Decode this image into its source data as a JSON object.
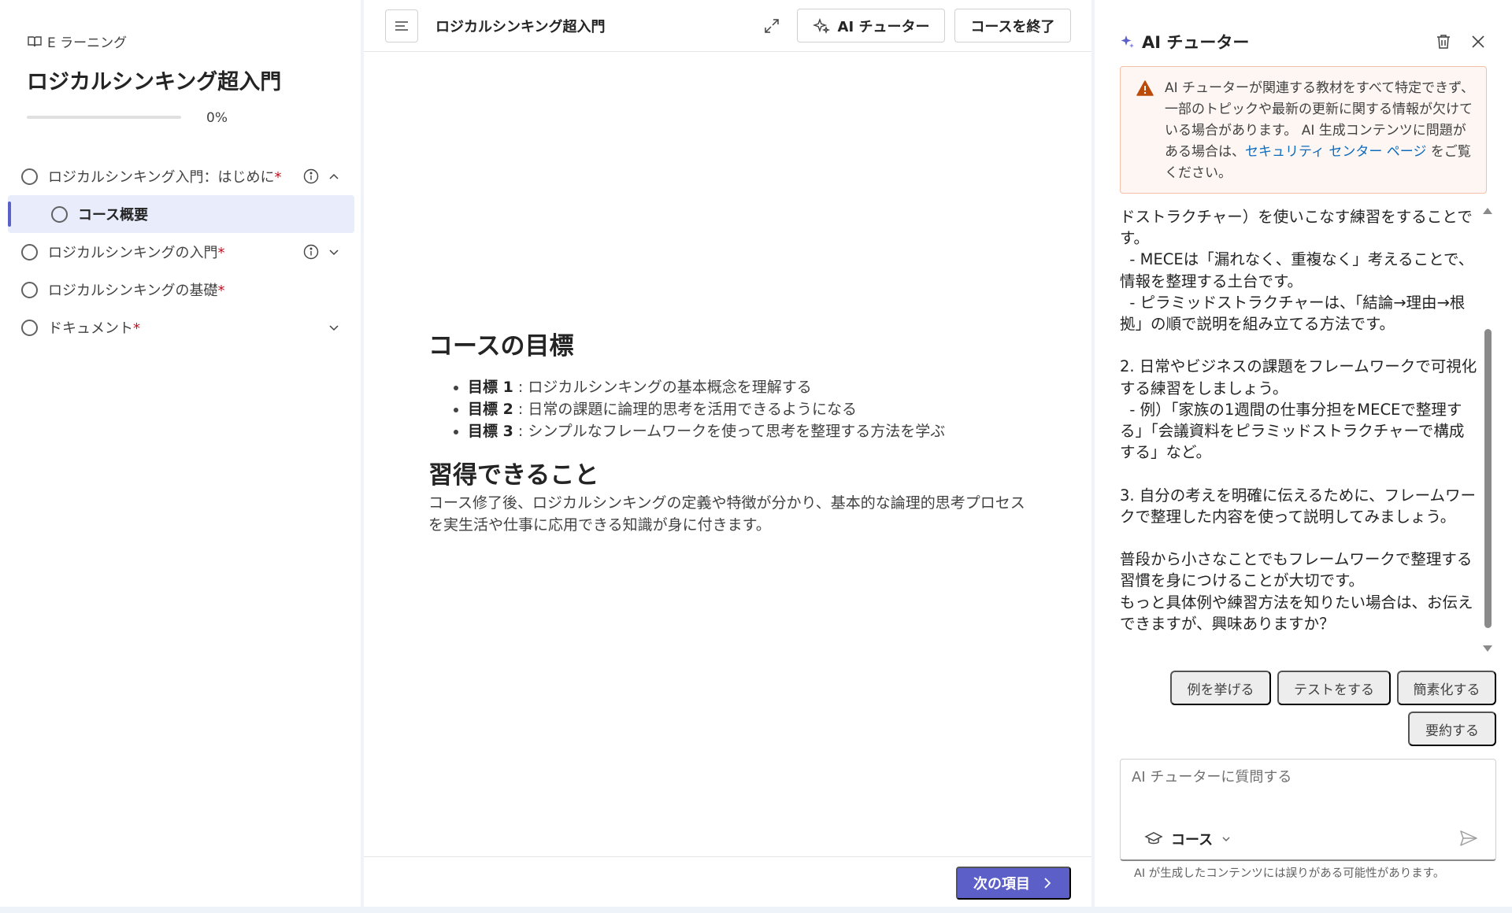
{
  "sidebar": {
    "brand": "E ラーニング",
    "course_title": "ロジカルシンキング超入門",
    "progress_percent": 0,
    "progress_text": "0%",
    "items": [
      {
        "label": "ロジカルシンキング入門：はじめに",
        "required": "*"
      },
      {
        "label": "コース概要"
      },
      {
        "label": "ロジカルシンキングの入門",
        "required": "*"
      },
      {
        "label": "ロジカルシンキングの基礎",
        "required": "*"
      },
      {
        "label": "ドキュメント",
        "required": "*"
      }
    ]
  },
  "main": {
    "title": "ロジカルシンキング超入門",
    "ai_tutor_button": "AI チューター",
    "end_course_button": "コースを終了",
    "goals_heading": "コースの目標",
    "goals": [
      {
        "label": "目標 1",
        "text": " : ロジカルシンキングの基本概念を理解する"
      },
      {
        "label": "目標 2",
        "text": " : 日常の課題に論理的思考を活用できるようになる"
      },
      {
        "label": "目標 3",
        "text": " : シンプルなフレームワークを使って思考を整理する方法を学ぶ"
      }
    ],
    "learn_heading": "習得できること",
    "learn_text": "コース修了後、ロジカルシンキングの定義や特徴が分かり、基本的な論理的思考プロセスを実生活や仕事に応用できる知識が身に付きます。",
    "next_button": "次の項目"
  },
  "tutor": {
    "title": "AI チューター",
    "warning_text": "AI チューターが関連する教材をすべて特定できず、一部のトピックや最新の更新に関する情報が欠けている場合があります。 AI 生成コンテンツに問題がある場合は、",
    "warning_link": "セキュリティ センター ページ",
    "warning_suffix": " をご覧ください。",
    "chat_text": "ドストラクチャー）を使いこなす練習をすることです。\n  - MECEは「漏れなく、重複なく」考えることで、情報を整理する土台です。\n  - ピラミッドストラクチャーは、「結論→理由→根拠」の順で説明を組み立てる方法です。\n\n2. 日常やビジネスの課題をフレームワークで可視化する練習をしましょう。\n  - 例）「家族の1週間の仕事分担をMECEで整理する」「会議資料をピラミッドストラクチャーで構成する」など。\n\n3. 自分の考えを明確に伝えるために、フレームワークで整理した内容を使って説明してみましょう。\n\n普段から小さなことでもフレームワークで整理する習慣を身につけることが大切です。\nもっと具体例や練習方法を知りたい場合は、お伝えできますが、興味ありますか？",
    "chips": [
      "例を挙げる",
      "テストをする",
      "簡素化する",
      "要約する"
    ],
    "input_placeholder": "AI チューターに質問する",
    "scope_label": "コース",
    "disclaimer": "AI が生成したコンテンツには誤りがある可能性があります。"
  },
  "colors": {
    "accent": "#5b5fc7",
    "required": "#c50f1f",
    "warning_icon": "#bc4b09",
    "link": "#0f6cbd"
  },
  "icons": [
    "book-icon",
    "info-icon",
    "chevron-up-icon",
    "chevron-down-icon",
    "menu-icon",
    "expand-icon",
    "sparkle-icon",
    "trash-icon",
    "close-icon",
    "warning-icon",
    "hat-icon",
    "send-icon",
    "chevron-right-icon"
  ]
}
